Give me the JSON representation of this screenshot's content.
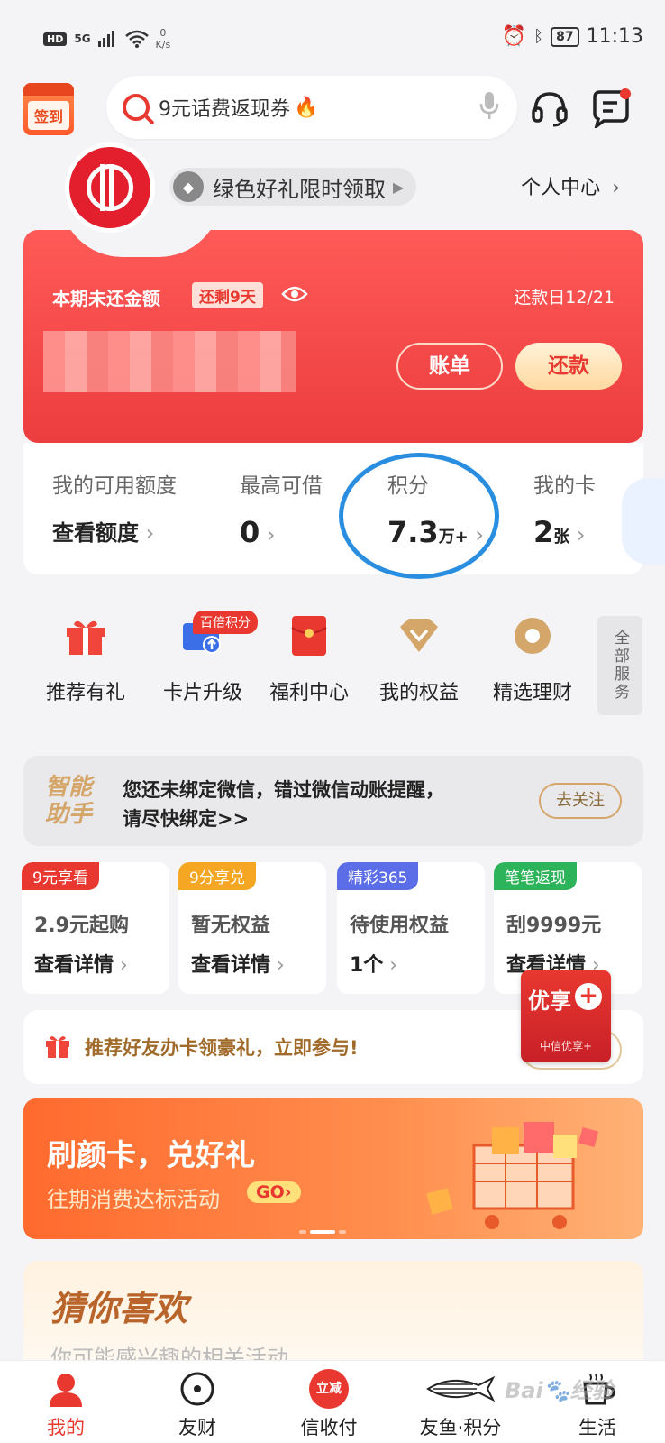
{
  "status_bar": {
    "hd": "HD",
    "signal": "5G",
    "net_speed": "0",
    "net_unit": "K/s",
    "battery": "87",
    "time": "11:13"
  },
  "header": {
    "signin_label": "签到",
    "search_text": "9元话费返现券",
    "icons": [
      "search-icon",
      "fire-icon",
      "mic-icon",
      "headset-icon",
      "message-icon"
    ]
  },
  "card": {
    "green_promo": "绿色好礼限时领取",
    "personal_center": "个人中心",
    "due_label": "本期未还金额",
    "days_left": "还剩9天",
    "due_date": "还款日12/21",
    "bill_button": "账单",
    "pay_button": "还款"
  },
  "stats": [
    {
      "title": "我的可用额度",
      "value": "查看额度",
      "unit": ""
    },
    {
      "title": "最高可借",
      "value": "0",
      "unit": ""
    },
    {
      "title": "积分",
      "value": "7.3",
      "unit": "万+"
    },
    {
      "title": "我的卡",
      "value": "2",
      "unit": "张"
    }
  ],
  "quick": {
    "hot_badge": "百倍积分",
    "items": [
      "推荐有礼",
      "卡片升级",
      "福利中心",
      "我的权益",
      "精选理财"
    ],
    "all_services": "全部服务"
  },
  "wechat": {
    "brand": "智能助手",
    "line1": "您还未绑定微信，错过微信动账提醒，",
    "line2": "请尽快绑定>>",
    "button": "去关注"
  },
  "mini_cards": [
    {
      "tag": "9元享看",
      "title": "2.9元起购",
      "value": "查看详情",
      "color": "#e8382f"
    },
    {
      "tag": "9分享兑",
      "title": "暂无权益",
      "value": "查看详情",
      "color": "#f5a623"
    },
    {
      "tag": "精彩365",
      "title": "待使用权益",
      "value": "1个",
      "color": "#5b6ee8"
    },
    {
      "tag": "笔笔返现",
      "title": "刮9999元",
      "value": "查看详情",
      "color": "#2db35a"
    }
  ],
  "refer": {
    "text": "推荐好友办卡领豪礼，立即参与!",
    "youxiang_title": "优享",
    "youxiang_sub": "中信优享+"
  },
  "banner": {
    "title": "刷颜卡，兑好礼",
    "subtitle": "往期消费达标活动",
    "go": "GO›"
  },
  "guess": {
    "title": "猜你喜欢",
    "subtitle": "你可能感兴趣的相关活动"
  },
  "nav": {
    "items": [
      "我的",
      "友财",
      "信收付",
      "友鱼·积分",
      "生活"
    ],
    "liji": "立减"
  },
  "colors": {
    "brand_red": "#e8382f",
    "highlight_circle": "#2a8ee0",
    "gold": "#d4a66a"
  }
}
